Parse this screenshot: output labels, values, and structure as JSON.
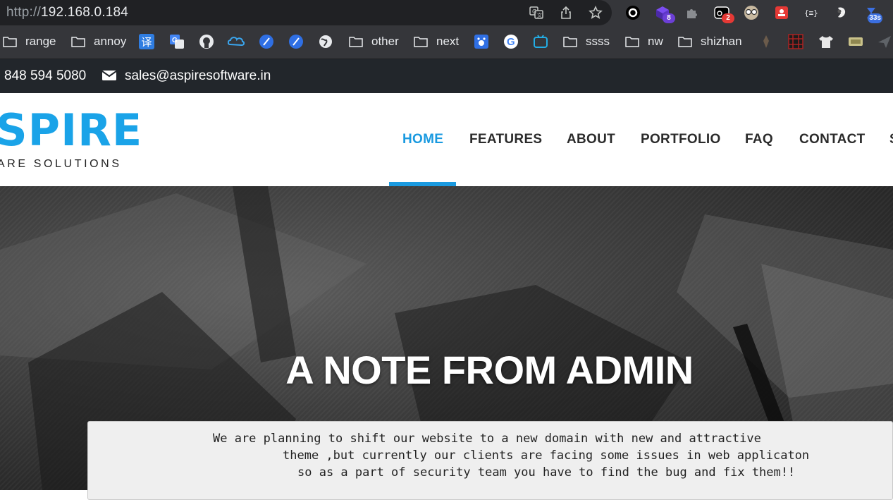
{
  "browser": {
    "url_protocol": "http://",
    "url_host": "192.168.0.184",
    "extensions": [
      {
        "name": "circle-extension-icon"
      },
      {
        "name": "cube-extension-icon",
        "badge": "8",
        "badge_color": "#6c3fd6"
      },
      {
        "name": "puzzle-extension-icon"
      },
      {
        "name": "camera-extension-icon",
        "badge": "2",
        "badge_color": "#e53935"
      },
      {
        "name": "glasses-extension-icon"
      },
      {
        "name": "bug-extension-icon"
      },
      {
        "name": "json-extension-icon",
        "label": "{≡}"
      },
      {
        "name": "hand-extension-icon"
      },
      {
        "name": "timer-extension-icon",
        "badge": "33s",
        "badge_color": "#3b6fe0"
      }
    ]
  },
  "bookmarks": {
    "folders": {
      "range": "range",
      "annoy": "annoy",
      "other": "other",
      "next": "next",
      "ssss": "ssss",
      "nw": "nw",
      "shizhan": "shizhan"
    },
    "translate_glyph": "译"
  },
  "infobar": {
    "phone": "848 594 5080",
    "email": "sales@aspiresoftware.in"
  },
  "logo": {
    "main": "SPIRE",
    "sub": "ARE SOLUTIONS"
  },
  "nav": {
    "home": "HOME",
    "features": "FEATURES",
    "about": "ABOUT",
    "portfolio": "PORTFOLIO",
    "faq": "FAQ",
    "contact": "CONTACT",
    "overflow": "S"
  },
  "hero": {
    "title": "A NOTE FROM ADMIN"
  },
  "note": {
    "line1": "We are planning to shift our website to a new domain with new and attractive",
    "line2": "theme ,but currently our clients are facing some issues in web applicaton",
    "line3": "so as a part of security team you have to find the bug and fix them!!"
  },
  "colors": {
    "accent": "#1a9ae0",
    "infobar_bg": "#22262b"
  }
}
